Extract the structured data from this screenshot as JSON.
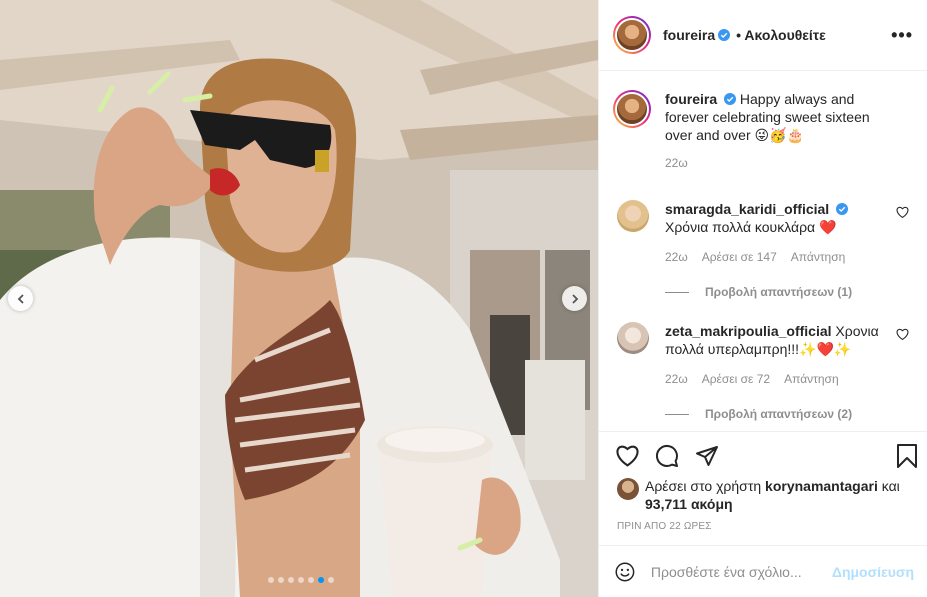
{
  "post": {
    "author": "foureira",
    "follow_status": "• Ακολουθείτε",
    "more_label": "•••",
    "caption": "Happy always and forever celebrating sweet sixteen over and over 😜🥳🎂",
    "caption_time": "22ω",
    "carousel": {
      "total": 7,
      "active_index": 5
    }
  },
  "comments": [
    {
      "username": "smaragda_karidi_official",
      "verified": true,
      "text": "Χρόνια πολλά κουκλάρα ❤️",
      "time": "22ω",
      "likes": "Αρέσει σε 147",
      "reply": "Απάντηση",
      "view_replies": "Προβολή απαντήσεων (1)"
    },
    {
      "username": "zeta_makripoulia_official",
      "verified": false,
      "text": "Χρονια πολλά υπερλαμπρη!!!✨❤️✨",
      "time": "22ω",
      "likes": "Αρέσει σε 72",
      "reply": "Απάντηση",
      "view_replies": "Προβολή απαντήσεων (2)"
    }
  ],
  "likes": {
    "prefix": "Αρέσει στο χρήστη",
    "user": "korynamantagari",
    "conjunction": "και",
    "count": "93,711 ακόμη"
  },
  "posted_ago": "ΠΡΙΝ ΑΠΟ 22 ΩΡΕΣ",
  "add_comment": {
    "placeholder": "Προσθέστε ένα σχόλιο...",
    "publish_label": "Δημοσίευση"
  },
  "colors": {
    "accent": "#0095f6",
    "verified": "#3897f0",
    "heart_red": "#ed4956",
    "muted": "#8e8e8e"
  },
  "icons": [
    "chevron-left-icon",
    "chevron-right-icon",
    "heart-icon",
    "comment-icon",
    "share-icon",
    "bookmark-icon",
    "emoji-icon",
    "more-icon",
    "verified-icon"
  ]
}
